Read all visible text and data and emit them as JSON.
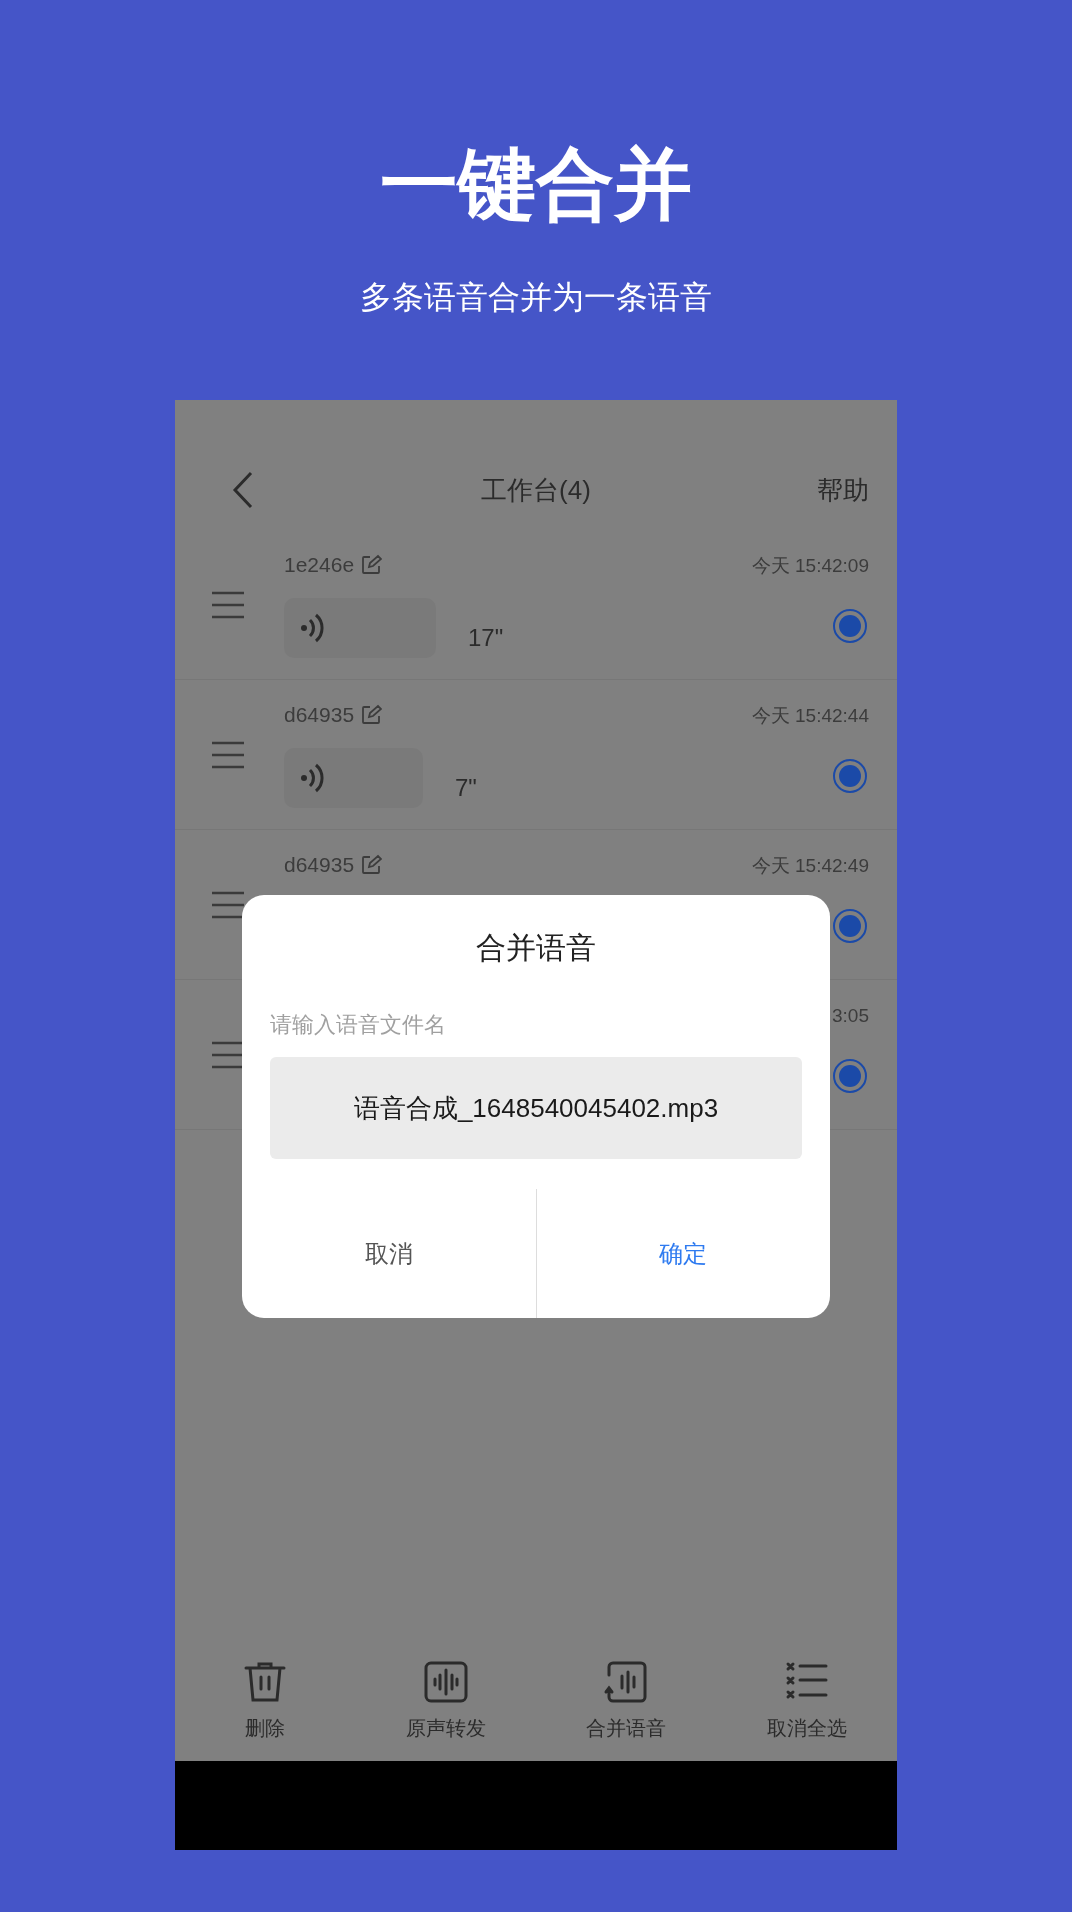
{
  "headline": "一键合并",
  "subtitle": "多条语音合并为一条语音",
  "nav": {
    "title": "工作台(4)",
    "action": "帮助"
  },
  "rows": [
    {
      "name": "1e246e",
      "time": "今天 15:42:09",
      "duration": "17\"",
      "selected": true
    },
    {
      "name": "d64935",
      "time": "今天 15:42:44",
      "duration": "7\"",
      "selected": true
    },
    {
      "name": "d64935",
      "time": "今天 15:42:49",
      "selected": true
    },
    {
      "time": "3:05",
      "selected": true
    }
  ],
  "dialog": {
    "title": "合并语音",
    "label": "请输入语音文件名",
    "value": "语音合成_1648540045402.mp3",
    "buttons": [
      {
        "label": "取消",
        "kind": "cancel"
      },
      {
        "label": "确定",
        "kind": "confirm"
      }
    ]
  },
  "toolbar": [
    {
      "label": "删除",
      "kind": "delete"
    },
    {
      "label": "原声转发",
      "kind": "forward"
    },
    {
      "label": "合并语音",
      "kind": "merge"
    },
    {
      "label": "取消全选",
      "kind": "deselect"
    }
  ]
}
